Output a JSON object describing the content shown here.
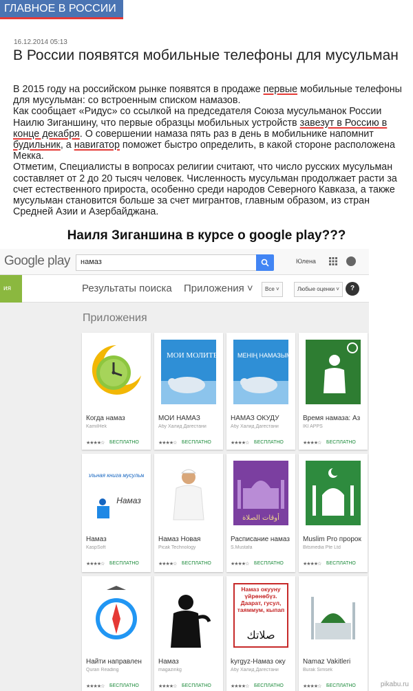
{
  "news": {
    "section_tab": "ГЛАВНОЕ В РОССИИ",
    "date": "16.12.2014 05:13",
    "headline": "В России появятся мобильные телефоны для мусульман",
    "p1_a": "В 2015 году на российском рынке появятся в продаже ",
    "p1_u": "первые",
    "p1_b": " мобильные телефоны для мусульман: со встроенным списком намазов.",
    "p2_a": "Как сообщает «Ридус» со ссылкой на председателя Союза мусульманок России Наилю Зиганшину, что первые образцы мобильных устройств ",
    "p2_u": "завезут в Россию в конце декабря",
    "p2_b": ". О совершении намаза пять раз в день в мобильнике напомнит ",
    "p2_u2": "будильник",
    "p2_c": ", а ",
    "p2_u3": "навигатор",
    "p2_d": " поможет быстро определить, в какой стороне расположена Мекка.",
    "p3": "Отметим, Специалисты в вопросах религии считают, что число русских мусульман составляет от 2 до 20 тысяч человек. Численность мусульман продолжает расти за счет естественного прироста, особенно среди народов Северного Кавказа, а также мусульман становится больше за счет мигрантов, главным образом, из стран Средней Азии и Азербайджана."
  },
  "caption": "Наиля Зиганшина в курсе о google play???",
  "play": {
    "logo": "Google play",
    "search_value": "намаз",
    "user": "Юлена",
    "side_label": "ия",
    "results_label": "Результаты поиска",
    "apps_label": "Приложения ˅",
    "filter_all": "Все ˅",
    "filter_rating": "Любые оценки ˅",
    "help": "?",
    "section_title": "Приложения",
    "accent": "#8bb83f",
    "search_color": "#4285f4",
    "apps": [
      {
        "title": "Когда намаз",
        "dev": "KamilHek",
        "stars": "★★★★☆",
        "price": "БЕСПЛАТНО"
      },
      {
        "title": "МОИ НАМАЗ",
        "dev": "Абу Халид Дагестани",
        "stars": "★★★★☆",
        "price": "БЕСПЛАТНО",
        "art_text": "МОИ МОЛИТВА"
      },
      {
        "title": "НАМАЗ ОКУДУ",
        "dev": "Абу Халид Дагестани",
        "stars": "★★★★☆",
        "price": "БЕСПЛАТНО",
        "art_text": "МЕНІҢ НАМАЗЫМ"
      },
      {
        "title": "Время намаза: Аз",
        "dev": "IKI APPS",
        "stars": "★★★★☆",
        "price": "БЕСПЛАТНО"
      },
      {
        "title": "Намаз",
        "dev": "KaspSoft",
        "stars": "★★★★☆",
        "price": "БЕСПЛАТНО",
        "art_text_1": "Настольная книга мусульманина",
        "art_text_2": "Намаз"
      },
      {
        "title": "Намаз Новая",
        "dev": "Picak Technology",
        "stars": "★★★★☆",
        "price": "БЕСПЛАТНО"
      },
      {
        "title": "Расписание намаз",
        "dev": "S.Mustafa",
        "stars": "★★★★☆",
        "price": "БЕСПЛАТНО",
        "art_text": "أوقات الصلاة"
      },
      {
        "title": "Muslim Pro пророк",
        "dev": "Bitsmedia Pte Ltd",
        "stars": "★★★★☆",
        "price": "БЕСПЛАТНО"
      },
      {
        "title": "Найти направлен",
        "dev": "Quran Reading",
        "stars": "★★★★☆",
        "price": "БЕСПЛАТНО"
      },
      {
        "title": "Намаз",
        "dev": "magazinkg",
        "stars": "★★★★☆",
        "price": "БЕСПЛАТНО"
      },
      {
        "title": "kyrgyz-Намаз оку",
        "dev": "Абу Халид Дагестани",
        "stars": "★★★★☆",
        "price": "БЕСПЛАТНО",
        "art_text": "Намаз окууну үйрөнөбүз. Даарат, гусул, таяммум, кыпап",
        "art_text_2": "صلاتك"
      },
      {
        "title": "Namaz Vakitleri",
        "dev": "Burak Simsek",
        "stars": "★★★★☆",
        "price": "БЕСПЛАТНО"
      }
    ]
  },
  "watermark": "pikabu.ru"
}
